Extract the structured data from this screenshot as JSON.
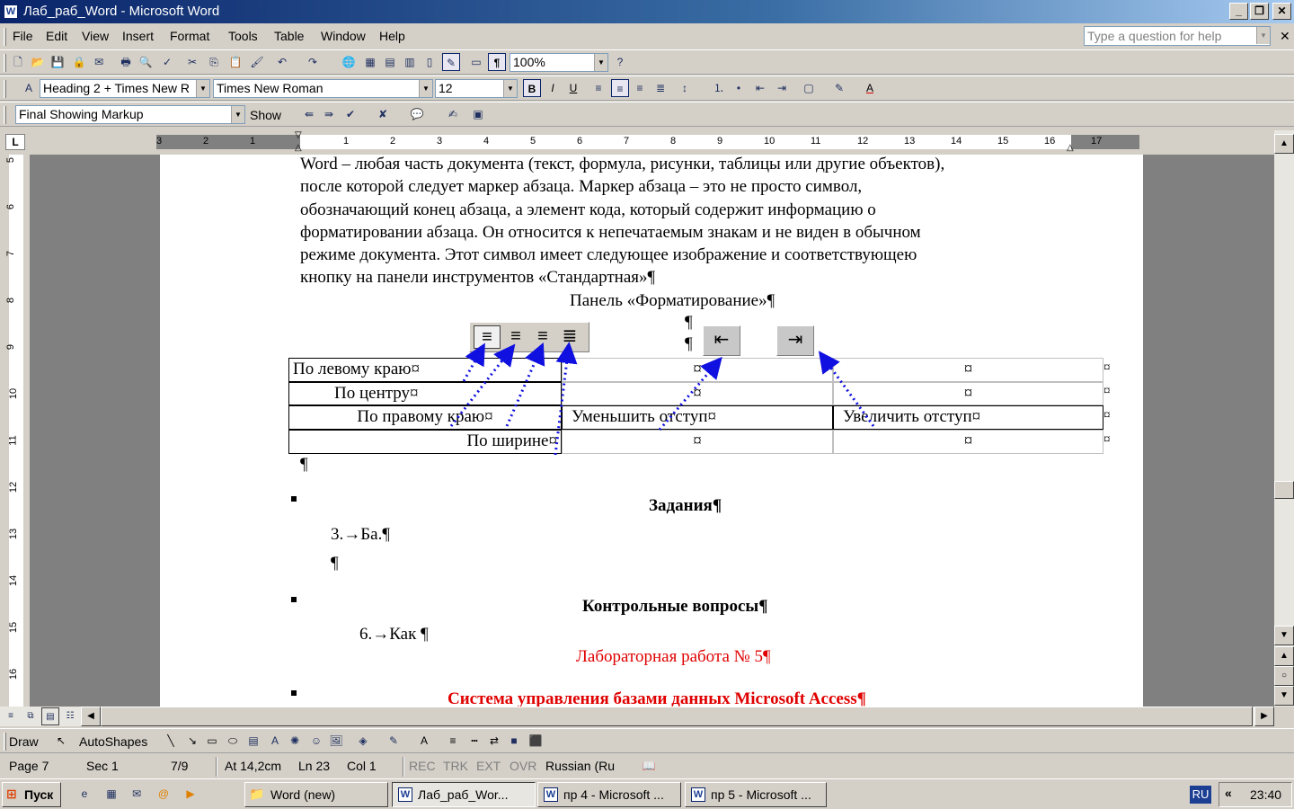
{
  "window": {
    "title": "Лаб_раб_Word - Microsoft Word"
  },
  "menu": [
    "File",
    "Edit",
    "View",
    "Insert",
    "Format",
    "Tools",
    "Table",
    "Window",
    "Help"
  ],
  "help_placeholder": "Type a question for help",
  "toolbar_standard": {
    "zoom": "100%"
  },
  "toolbar_formatting": {
    "style": "Heading 2 + Times New R",
    "font": "Times New Roman",
    "size": "12"
  },
  "toolbar_reviewing": {
    "markup": "Final Showing Markup",
    "show": "Show"
  },
  "ruler": {
    "h_left": [
      "3",
      "2",
      "1"
    ],
    "h_right": [
      "1",
      "2",
      "3",
      "4",
      "5",
      "6",
      "7",
      "8",
      "9",
      "10",
      "11",
      "12",
      "13",
      "14",
      "15",
      "16",
      "17"
    ],
    "v": [
      "5",
      "6",
      "7",
      "8",
      "9",
      "10",
      "11",
      "12",
      "13",
      "14",
      "15",
      "16"
    ],
    "corner": "L"
  },
  "document": {
    "paragraph": [
      "Word – любая часть документа (текст, формула, рисунки, таблицы или другие объектов),",
      "после которой следует маркер абзаца. Маркер абзаца – это не просто символ,",
      "обозначающий конец абзаца, а элемент кода, который содержит информацию о",
      "форматировании абзаца. Он относится к непечатаемым знакам и не виден в обычном",
      "режиме документа. Этот символ имеет следующее изображение и соответствующею",
      "кнопку на панели инструментов «Стандартная»¶"
    ],
    "caption": "Панель «Форматирование»¶",
    "pilcrow": "¶",
    "table": {
      "col1": [
        "По левому краю¤",
        "По центру¤",
        "По правому краю¤",
        "По  ширине¤"
      ],
      "col2": [
        "¤",
        "¤",
        "Уменьшить отступ¤",
        "¤"
      ],
      "col3": [
        "¤",
        "¤",
        "Увеличить отступ¤",
        "¤"
      ],
      "end": "¤"
    },
    "heading_tasks": "Задания¶",
    "item_3": "3.→Ба.¶",
    "heading_questions": "Контрольные вопросы¶",
    "item_6": "6.→Как ¶",
    "lab_title": "Лабораторная работа № 5¶",
    "access_title": "Система управления базами данных Microsoft Access¶"
  },
  "drawbar": {
    "draw": "Draw",
    "autoshapes": "AutoShapes"
  },
  "status": {
    "page": "Page 7",
    "sec": "Sec 1",
    "pages": "7/9",
    "at": "At 14,2cm",
    "ln": "Ln 23",
    "col": "Col 1",
    "rec": "REC",
    "trk": "TRK",
    "ext": "EXT",
    "ovr": "OVR",
    "lang": "Russian (Ru"
  },
  "taskbar": {
    "start": "Пуск",
    "tasks": [
      "Word (new)",
      "Лаб_раб_Wor...",
      "пр 4 - Microsoft ...",
      "пр 5 - Microsoft ..."
    ],
    "lang": "RU",
    "clock": "23:40"
  },
  "colors": {
    "title_start": "#0a246a",
    "title_end": "#a6caf0",
    "red_text": "#e00000",
    "arrow_blue": "#1010e0"
  }
}
